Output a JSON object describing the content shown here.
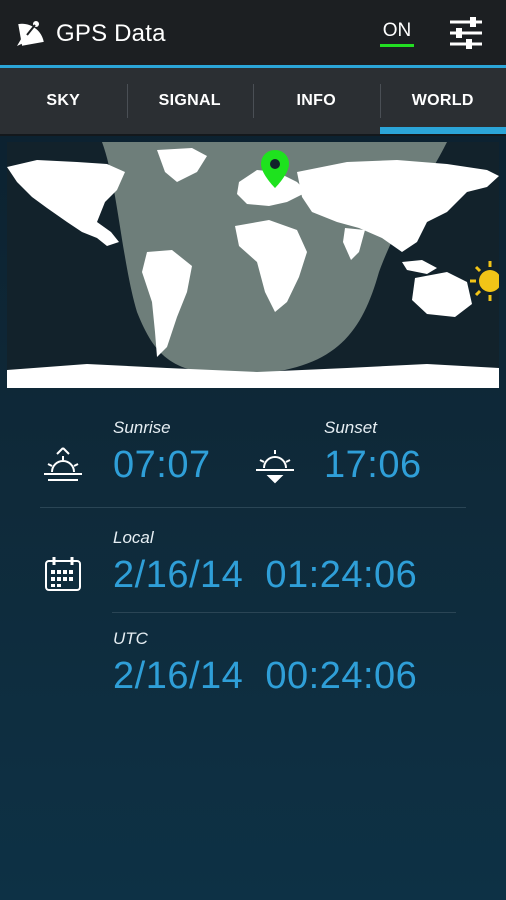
{
  "app": {
    "title": "GPS Data",
    "toggle_label": "ON"
  },
  "tabs": [
    {
      "label": "SKY"
    },
    {
      "label": "SIGNAL"
    },
    {
      "label": "INFO"
    },
    {
      "label": "WORLD",
      "active": true
    }
  ],
  "sun": {
    "sunrise_label": "Sunrise",
    "sunrise_value": "07:07",
    "sunset_label": "Sunset",
    "sunset_value": "17:06"
  },
  "time": {
    "local_label": "Local",
    "local_value": "2/16/14  01:24:06",
    "utc_label": "UTC",
    "utc_value": "2/16/14  00:24:06"
  },
  "colors": {
    "accent": "#2ba5d8",
    "toggle_on": "#22dd22",
    "location_marker": "#1ee21e",
    "sun": "#f2c417",
    "value_text": "#2f9fd8"
  },
  "icons": {
    "app": "satellite-dish-icon",
    "settings": "sliders-icon",
    "sunrise": "sunrise-icon",
    "sunset": "sunset-icon",
    "calendar": "calendar-icon",
    "location": "map-pin-icon",
    "sun": "sun-icon"
  }
}
